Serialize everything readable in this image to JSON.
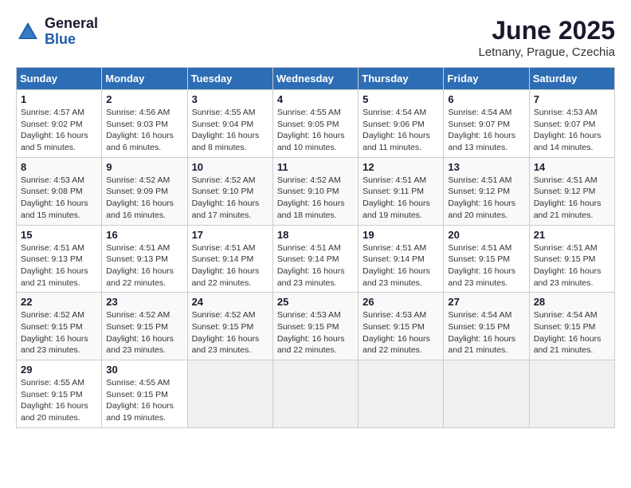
{
  "header": {
    "logo": {
      "general": "General",
      "blue": "Blue"
    },
    "title": "June 2025",
    "subtitle": "Letnany, Prague, Czechia"
  },
  "days_of_week": [
    "Sunday",
    "Monday",
    "Tuesday",
    "Wednesday",
    "Thursday",
    "Friday",
    "Saturday"
  ],
  "weeks": [
    [
      {
        "day": "1",
        "sunrise": "4:57 AM",
        "sunset": "9:02 PM",
        "daylight": "16 hours and 5 minutes."
      },
      {
        "day": "2",
        "sunrise": "4:56 AM",
        "sunset": "9:03 PM",
        "daylight": "16 hours and 6 minutes."
      },
      {
        "day": "3",
        "sunrise": "4:55 AM",
        "sunset": "9:04 PM",
        "daylight": "16 hours and 8 minutes."
      },
      {
        "day": "4",
        "sunrise": "4:55 AM",
        "sunset": "9:05 PM",
        "daylight": "16 hours and 10 minutes."
      },
      {
        "day": "5",
        "sunrise": "4:54 AM",
        "sunset": "9:06 PM",
        "daylight": "16 hours and 11 minutes."
      },
      {
        "day": "6",
        "sunrise": "4:54 AM",
        "sunset": "9:07 PM",
        "daylight": "16 hours and 13 minutes."
      },
      {
        "day": "7",
        "sunrise": "4:53 AM",
        "sunset": "9:07 PM",
        "daylight": "16 hours and 14 minutes."
      }
    ],
    [
      {
        "day": "8",
        "sunrise": "4:53 AM",
        "sunset": "9:08 PM",
        "daylight": "16 hours and 15 minutes."
      },
      {
        "day": "9",
        "sunrise": "4:52 AM",
        "sunset": "9:09 PM",
        "daylight": "16 hours and 16 minutes."
      },
      {
        "day": "10",
        "sunrise": "4:52 AM",
        "sunset": "9:10 PM",
        "daylight": "16 hours and 17 minutes."
      },
      {
        "day": "11",
        "sunrise": "4:52 AM",
        "sunset": "9:10 PM",
        "daylight": "16 hours and 18 minutes."
      },
      {
        "day": "12",
        "sunrise": "4:51 AM",
        "sunset": "9:11 PM",
        "daylight": "16 hours and 19 minutes."
      },
      {
        "day": "13",
        "sunrise": "4:51 AM",
        "sunset": "9:12 PM",
        "daylight": "16 hours and 20 minutes."
      },
      {
        "day": "14",
        "sunrise": "4:51 AM",
        "sunset": "9:12 PM",
        "daylight": "16 hours and 21 minutes."
      }
    ],
    [
      {
        "day": "15",
        "sunrise": "4:51 AM",
        "sunset": "9:13 PM",
        "daylight": "16 hours and 21 minutes."
      },
      {
        "day": "16",
        "sunrise": "4:51 AM",
        "sunset": "9:13 PM",
        "daylight": "16 hours and 22 minutes."
      },
      {
        "day": "17",
        "sunrise": "4:51 AM",
        "sunset": "9:14 PM",
        "daylight": "16 hours and 22 minutes."
      },
      {
        "day": "18",
        "sunrise": "4:51 AM",
        "sunset": "9:14 PM",
        "daylight": "16 hours and 23 minutes."
      },
      {
        "day": "19",
        "sunrise": "4:51 AM",
        "sunset": "9:14 PM",
        "daylight": "16 hours and 23 minutes."
      },
      {
        "day": "20",
        "sunrise": "4:51 AM",
        "sunset": "9:15 PM",
        "daylight": "16 hours and 23 minutes."
      },
      {
        "day": "21",
        "sunrise": "4:51 AM",
        "sunset": "9:15 PM",
        "daylight": "16 hours and 23 minutes."
      }
    ],
    [
      {
        "day": "22",
        "sunrise": "4:52 AM",
        "sunset": "9:15 PM",
        "daylight": "16 hours and 23 minutes."
      },
      {
        "day": "23",
        "sunrise": "4:52 AM",
        "sunset": "9:15 PM",
        "daylight": "16 hours and 23 minutes."
      },
      {
        "day": "24",
        "sunrise": "4:52 AM",
        "sunset": "9:15 PM",
        "daylight": "16 hours and 23 minutes."
      },
      {
        "day": "25",
        "sunrise": "4:53 AM",
        "sunset": "9:15 PM",
        "daylight": "16 hours and 22 minutes."
      },
      {
        "day": "26",
        "sunrise": "4:53 AM",
        "sunset": "9:15 PM",
        "daylight": "16 hours and 22 minutes."
      },
      {
        "day": "27",
        "sunrise": "4:54 AM",
        "sunset": "9:15 PM",
        "daylight": "16 hours and 21 minutes."
      },
      {
        "day": "28",
        "sunrise": "4:54 AM",
        "sunset": "9:15 PM",
        "daylight": "16 hours and 21 minutes."
      }
    ],
    [
      {
        "day": "29",
        "sunrise": "4:55 AM",
        "sunset": "9:15 PM",
        "daylight": "16 hours and 20 minutes."
      },
      {
        "day": "30",
        "sunrise": "4:55 AM",
        "sunset": "9:15 PM",
        "daylight": "16 hours and 19 minutes."
      },
      null,
      null,
      null,
      null,
      null
    ]
  ],
  "labels": {
    "sunrise": "Sunrise:",
    "sunset": "Sunset:",
    "daylight": "Daylight:"
  }
}
